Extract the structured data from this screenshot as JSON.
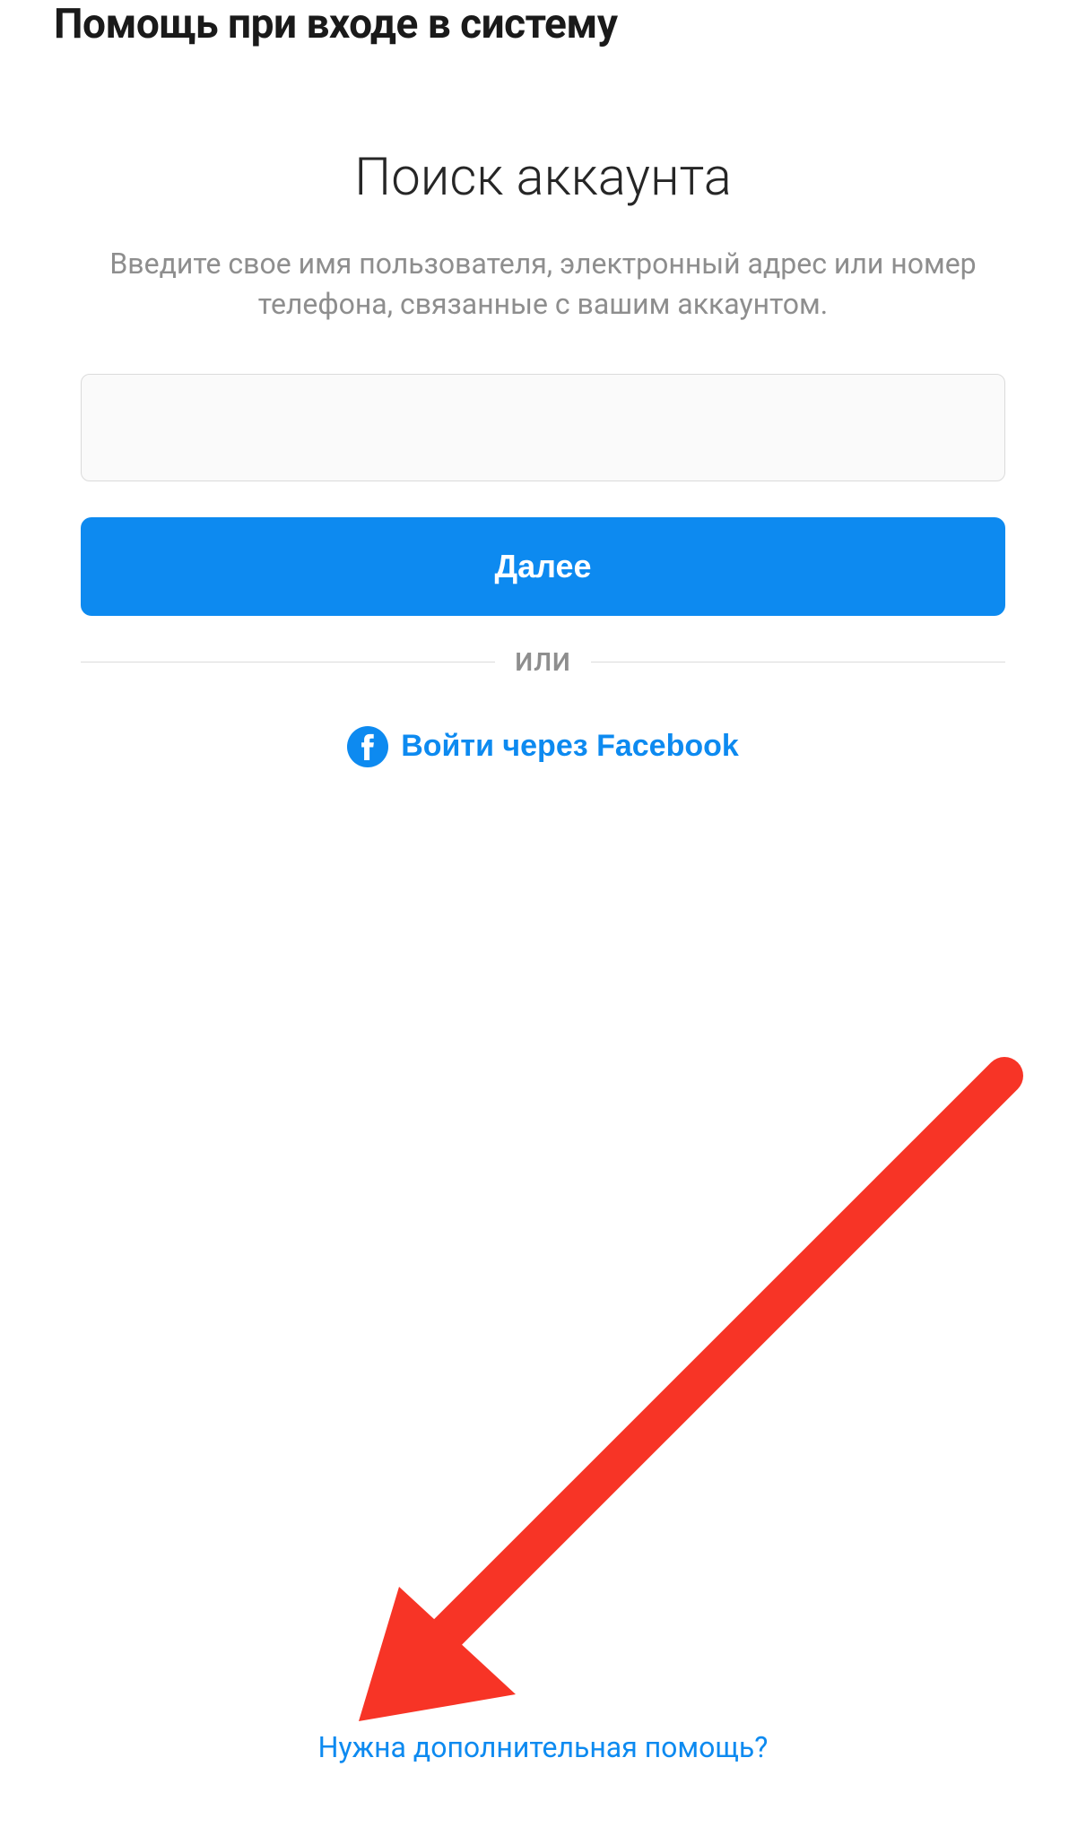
{
  "header": {
    "title": "Помощь при входе в систему"
  },
  "card": {
    "title": "Поиск аккаунта",
    "subtitle": "Введите свое имя пользователя, электронный адрес или номер телефона, связанные с вашим аккаунтом.",
    "input_value": "",
    "next_button": "Далее",
    "divider": "ИЛИ",
    "facebook_login": "Войти через Facebook"
  },
  "footer": {
    "help_link": "Нужна дополнительная помощь?"
  },
  "colors": {
    "primary": "#0d8af0",
    "text_secondary": "#8e8e8e",
    "border": "#dbdbdb",
    "input_bg": "#fafafa",
    "annotation_red": "#f73426"
  }
}
